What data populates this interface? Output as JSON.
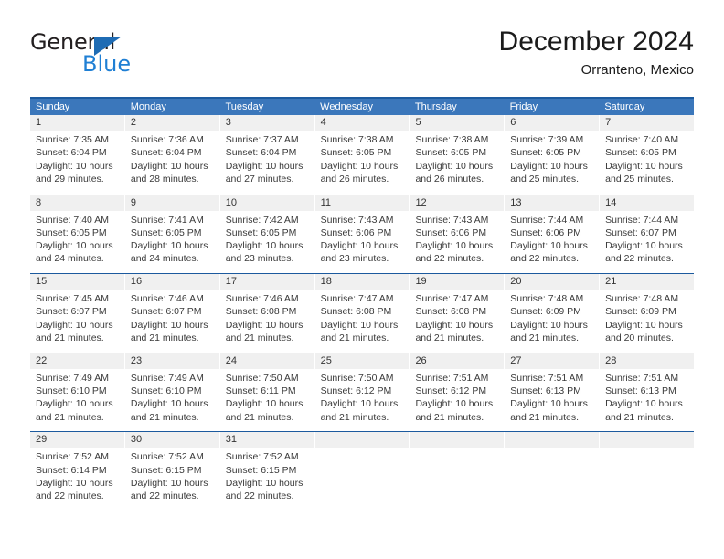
{
  "logo": {
    "word_one": "General",
    "word_two": "Blue",
    "triangle_color": "#1f6cb4",
    "blue_text_color": "#1f7fd4"
  },
  "header": {
    "title": "December 2024",
    "subtitle": "Orranteno, Mexico"
  },
  "theme": {
    "header_bg": "#3b77bb",
    "header_rule": "#1c5a9e",
    "daynum_bg": "#f0f0f0",
    "cell_bg": "#ffffff",
    "text": "#3a3a3a"
  },
  "weekdays": [
    "Sunday",
    "Monday",
    "Tuesday",
    "Wednesday",
    "Thursday",
    "Friday",
    "Saturday"
  ],
  "weeks": [
    [
      {
        "day": "1",
        "sunrise": "Sunrise: 7:35 AM",
        "sunset": "Sunset: 6:04 PM",
        "daylight_line1": "Daylight: 10 hours",
        "daylight_line2": "and 29 minutes."
      },
      {
        "day": "2",
        "sunrise": "Sunrise: 7:36 AM",
        "sunset": "Sunset: 6:04 PM",
        "daylight_line1": "Daylight: 10 hours",
        "daylight_line2": "and 28 minutes."
      },
      {
        "day": "3",
        "sunrise": "Sunrise: 7:37 AM",
        "sunset": "Sunset: 6:04 PM",
        "daylight_line1": "Daylight: 10 hours",
        "daylight_line2": "and 27 minutes."
      },
      {
        "day": "4",
        "sunrise": "Sunrise: 7:38 AM",
        "sunset": "Sunset: 6:05 PM",
        "daylight_line1": "Daylight: 10 hours",
        "daylight_line2": "and 26 minutes."
      },
      {
        "day": "5",
        "sunrise": "Sunrise: 7:38 AM",
        "sunset": "Sunset: 6:05 PM",
        "daylight_line1": "Daylight: 10 hours",
        "daylight_line2": "and 26 minutes."
      },
      {
        "day": "6",
        "sunrise": "Sunrise: 7:39 AM",
        "sunset": "Sunset: 6:05 PM",
        "daylight_line1": "Daylight: 10 hours",
        "daylight_line2": "and 25 minutes."
      },
      {
        "day": "7",
        "sunrise": "Sunrise: 7:40 AM",
        "sunset": "Sunset: 6:05 PM",
        "daylight_line1": "Daylight: 10 hours",
        "daylight_line2": "and 25 minutes."
      }
    ],
    [
      {
        "day": "8",
        "sunrise": "Sunrise: 7:40 AM",
        "sunset": "Sunset: 6:05 PM",
        "daylight_line1": "Daylight: 10 hours",
        "daylight_line2": "and 24 minutes."
      },
      {
        "day": "9",
        "sunrise": "Sunrise: 7:41 AM",
        "sunset": "Sunset: 6:05 PM",
        "daylight_line1": "Daylight: 10 hours",
        "daylight_line2": "and 24 minutes."
      },
      {
        "day": "10",
        "sunrise": "Sunrise: 7:42 AM",
        "sunset": "Sunset: 6:05 PM",
        "daylight_line1": "Daylight: 10 hours",
        "daylight_line2": "and 23 minutes."
      },
      {
        "day": "11",
        "sunrise": "Sunrise: 7:43 AM",
        "sunset": "Sunset: 6:06 PM",
        "daylight_line1": "Daylight: 10 hours",
        "daylight_line2": "and 23 minutes."
      },
      {
        "day": "12",
        "sunrise": "Sunrise: 7:43 AM",
        "sunset": "Sunset: 6:06 PM",
        "daylight_line1": "Daylight: 10 hours",
        "daylight_line2": "and 22 minutes."
      },
      {
        "day": "13",
        "sunrise": "Sunrise: 7:44 AM",
        "sunset": "Sunset: 6:06 PM",
        "daylight_line1": "Daylight: 10 hours",
        "daylight_line2": "and 22 minutes."
      },
      {
        "day": "14",
        "sunrise": "Sunrise: 7:44 AM",
        "sunset": "Sunset: 6:07 PM",
        "daylight_line1": "Daylight: 10 hours",
        "daylight_line2": "and 22 minutes."
      }
    ],
    [
      {
        "day": "15",
        "sunrise": "Sunrise: 7:45 AM",
        "sunset": "Sunset: 6:07 PM",
        "daylight_line1": "Daylight: 10 hours",
        "daylight_line2": "and 21 minutes."
      },
      {
        "day": "16",
        "sunrise": "Sunrise: 7:46 AM",
        "sunset": "Sunset: 6:07 PM",
        "daylight_line1": "Daylight: 10 hours",
        "daylight_line2": "and 21 minutes."
      },
      {
        "day": "17",
        "sunrise": "Sunrise: 7:46 AM",
        "sunset": "Sunset: 6:08 PM",
        "daylight_line1": "Daylight: 10 hours",
        "daylight_line2": "and 21 minutes."
      },
      {
        "day": "18",
        "sunrise": "Sunrise: 7:47 AM",
        "sunset": "Sunset: 6:08 PM",
        "daylight_line1": "Daylight: 10 hours",
        "daylight_line2": "and 21 minutes."
      },
      {
        "day": "19",
        "sunrise": "Sunrise: 7:47 AM",
        "sunset": "Sunset: 6:08 PM",
        "daylight_line1": "Daylight: 10 hours",
        "daylight_line2": "and 21 minutes."
      },
      {
        "day": "20",
        "sunrise": "Sunrise: 7:48 AM",
        "sunset": "Sunset: 6:09 PM",
        "daylight_line1": "Daylight: 10 hours",
        "daylight_line2": "and 21 minutes."
      },
      {
        "day": "21",
        "sunrise": "Sunrise: 7:48 AM",
        "sunset": "Sunset: 6:09 PM",
        "daylight_line1": "Daylight: 10 hours",
        "daylight_line2": "and 20 minutes."
      }
    ],
    [
      {
        "day": "22",
        "sunrise": "Sunrise: 7:49 AM",
        "sunset": "Sunset: 6:10 PM",
        "daylight_line1": "Daylight: 10 hours",
        "daylight_line2": "and 21 minutes."
      },
      {
        "day": "23",
        "sunrise": "Sunrise: 7:49 AM",
        "sunset": "Sunset: 6:10 PM",
        "daylight_line1": "Daylight: 10 hours",
        "daylight_line2": "and 21 minutes."
      },
      {
        "day": "24",
        "sunrise": "Sunrise: 7:50 AM",
        "sunset": "Sunset: 6:11 PM",
        "daylight_line1": "Daylight: 10 hours",
        "daylight_line2": "and 21 minutes."
      },
      {
        "day": "25",
        "sunrise": "Sunrise: 7:50 AM",
        "sunset": "Sunset: 6:12 PM",
        "daylight_line1": "Daylight: 10 hours",
        "daylight_line2": "and 21 minutes."
      },
      {
        "day": "26",
        "sunrise": "Sunrise: 7:51 AM",
        "sunset": "Sunset: 6:12 PM",
        "daylight_line1": "Daylight: 10 hours",
        "daylight_line2": "and 21 minutes."
      },
      {
        "day": "27",
        "sunrise": "Sunrise: 7:51 AM",
        "sunset": "Sunset: 6:13 PM",
        "daylight_line1": "Daylight: 10 hours",
        "daylight_line2": "and 21 minutes."
      },
      {
        "day": "28",
        "sunrise": "Sunrise: 7:51 AM",
        "sunset": "Sunset: 6:13 PM",
        "daylight_line1": "Daylight: 10 hours",
        "daylight_line2": "and 21 minutes."
      }
    ],
    [
      {
        "day": "29",
        "sunrise": "Sunrise: 7:52 AM",
        "sunset": "Sunset: 6:14 PM",
        "daylight_line1": "Daylight: 10 hours",
        "daylight_line2": "and 22 minutes."
      },
      {
        "day": "30",
        "sunrise": "Sunrise: 7:52 AM",
        "sunset": "Sunset: 6:15 PM",
        "daylight_line1": "Daylight: 10 hours",
        "daylight_line2": "and 22 minutes."
      },
      {
        "day": "31",
        "sunrise": "Sunrise: 7:52 AM",
        "sunset": "Sunset: 6:15 PM",
        "daylight_line1": "Daylight: 10 hours",
        "daylight_line2": "and 22 minutes."
      },
      {
        "day": "",
        "sunrise": "",
        "sunset": "",
        "daylight_line1": "",
        "daylight_line2": ""
      },
      {
        "day": "",
        "sunrise": "",
        "sunset": "",
        "daylight_line1": "",
        "daylight_line2": ""
      },
      {
        "day": "",
        "sunrise": "",
        "sunset": "",
        "daylight_line1": "",
        "daylight_line2": ""
      },
      {
        "day": "",
        "sunrise": "",
        "sunset": "",
        "daylight_line1": "",
        "daylight_line2": ""
      }
    ]
  ]
}
